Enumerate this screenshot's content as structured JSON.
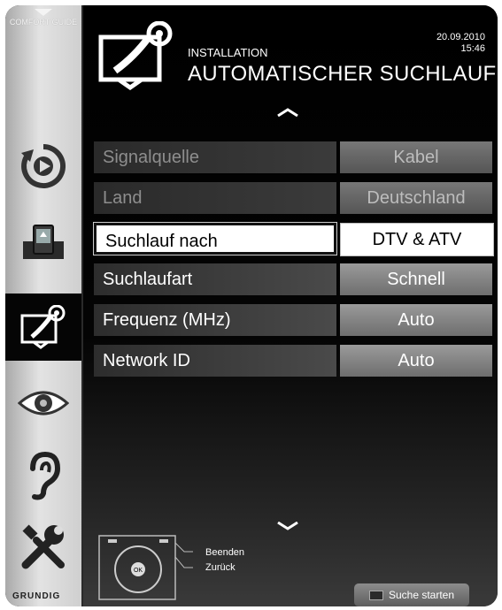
{
  "sidebar": {
    "comfort_guide": "COMFORT GUIDE",
    "brand": "GRUNDIG",
    "items": [
      {
        "icon": "source-icon"
      },
      {
        "icon": "media-icon"
      },
      {
        "icon": "installation-icon",
        "active": true
      },
      {
        "icon": "eye-icon"
      },
      {
        "icon": "ear-icon"
      },
      {
        "icon": "tools-icon"
      }
    ]
  },
  "header": {
    "section": "INSTALLATION",
    "title": "AUTOMATISCHER SUCHLAUF",
    "date": "20.09.2010",
    "time": "15:46"
  },
  "menu": {
    "rows": [
      {
        "label": "Signalquelle",
        "value": "Kabel",
        "state": "dim"
      },
      {
        "label": "Land",
        "value": "Deutschland",
        "state": "dim"
      },
      {
        "label": "Suchlauf nach",
        "value": "DTV & ATV",
        "state": "selected"
      },
      {
        "label": "Suchlaufart",
        "value": "Schnell",
        "state": "normal"
      },
      {
        "label": "Frequenz (MHz)",
        "value": "Auto",
        "state": "normal"
      },
      {
        "label": "Network ID",
        "value": "Auto",
        "state": "normal"
      }
    ]
  },
  "footer": {
    "legend_exit": "Beenden",
    "legend_back": "Zurück",
    "remote_ok": "OK",
    "start_button": "Suche starten"
  }
}
